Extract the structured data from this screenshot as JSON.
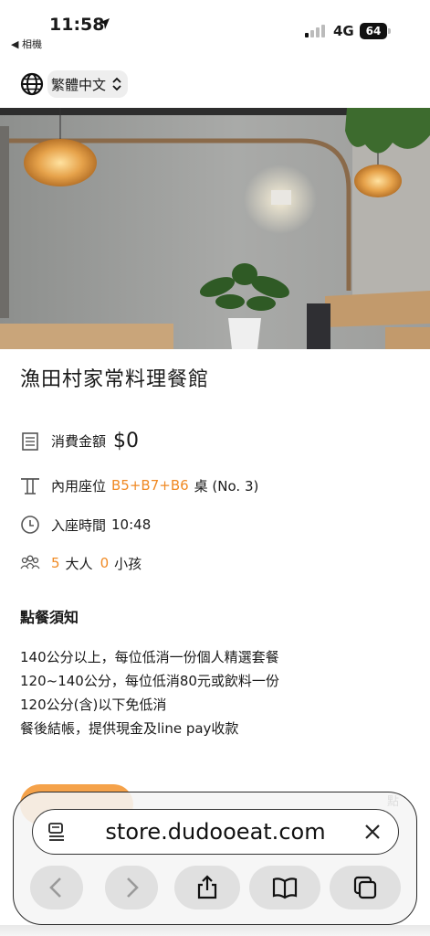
{
  "status_bar": {
    "time": "11:58",
    "back_app": "◀ 相機",
    "network": "4G",
    "battery": "64"
  },
  "language": {
    "label": "繁體中文"
  },
  "restaurant": {
    "name": "漁田村家常料理餐館",
    "amount_label": "消費金額",
    "amount_value": "$0",
    "seat_label": "內用座位",
    "seat_tables": "B5+B7+B6",
    "seat_suffix": "桌 (No. 3)",
    "time_label": "入座時間",
    "time_value": "10:48",
    "adults_count": "5",
    "adults_label": "大人",
    "children_count": "0",
    "children_label": "小孩"
  },
  "notice": {
    "title": "點餐須知",
    "lines": [
      "140公分以上，每位低消一份個人精選套餐",
      "120~140公分，每位低消80元或飲料一份",
      "120公分(含)以下免低消",
      "餐後結帳，提供現金及line pay收款"
    ]
  },
  "peek_text": "點",
  "browser": {
    "url": "store.dudooeat.com"
  },
  "colors": {
    "accent": "#f08a24"
  },
  "icons": [
    "location-arrow-icon",
    "signal-icon",
    "battery-icon",
    "globe-icon",
    "updown-chevron-icon",
    "receipt-icon",
    "table-icon",
    "clock-icon",
    "people-icon",
    "reader-icon",
    "close-icon",
    "back-icon",
    "forward-icon",
    "share-icon",
    "bookmarks-icon",
    "tabs-icon"
  ]
}
